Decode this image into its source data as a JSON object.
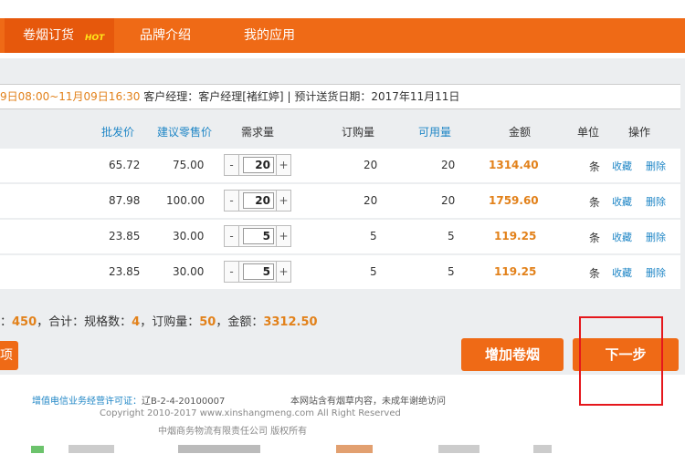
{
  "nav": {
    "tabs": [
      {
        "label": "卷烟订货",
        "badge": "HOT"
      },
      {
        "label": "品牌介绍"
      },
      {
        "label": "我的应用"
      }
    ]
  },
  "info": {
    "time_range": "9日08:00~11月09日16:30",
    "manager": "客户经理：客户经理[褚红婷]",
    "sep": "|",
    "delivery": "预计送货日期：2017年11月11日"
  },
  "table": {
    "headers": {
      "wholesale": "批发价",
      "retail": "建议零售价",
      "demand": "需求量",
      "order": "订购量",
      "available": "可用量",
      "amount": "金额",
      "unit": "单位",
      "action": "操作"
    },
    "rows": [
      {
        "wholesale": "65.72",
        "retail": "75.00",
        "demand": "20",
        "order": "20",
        "available": "20",
        "amount": "1314.40",
        "unit": "条",
        "fav": "收藏",
        "del": "删除"
      },
      {
        "wholesale": "87.98",
        "retail": "100.00",
        "demand": "20",
        "order": "20",
        "available": "20",
        "amount": "1759.60",
        "unit": "条",
        "fav": "收藏",
        "del": "删除"
      },
      {
        "wholesale": "23.85",
        "retail": "30.00",
        "demand": "5",
        "order": "5",
        "available": "5",
        "amount": "119.25",
        "unit": "条",
        "fav": "收藏",
        "del": "删除"
      },
      {
        "wholesale": "23.85",
        "retail": "30.00",
        "demand": "5",
        "order": "5",
        "available": "5",
        "amount": "119.25",
        "unit": "条",
        "fav": "收藏",
        "del": "删除"
      }
    ],
    "minus": "-",
    "plus": "+"
  },
  "summary": {
    "lead": "：",
    "total_demand": "450",
    "total_label": "，合计：规格数：",
    "spec_count": "4",
    "order_label": "，订购量：",
    "order_total": "50",
    "amount_label": "，金额：",
    "amount_total": "3312.50"
  },
  "buttons": {
    "left_partial": "项",
    "add": "增加卷烟",
    "next": "下一步"
  },
  "footer": {
    "license_label": "增值电信业务经营许可证：",
    "license_no": "辽B-2-4-20100007",
    "notice": "本网站含有烟草内容，未成年谢绝访问",
    "copyright": "Copyright 2010-2017 www.xinshangmeng.com All Right Reserved",
    "company": "中烟商务物流有限责任公司 版权所有"
  },
  "colors": {
    "brand_orange": "#ef6a16",
    "amount_orange": "#e2811a",
    "link_blue": "#1f86c6",
    "highlight_red": "#e5171c"
  }
}
